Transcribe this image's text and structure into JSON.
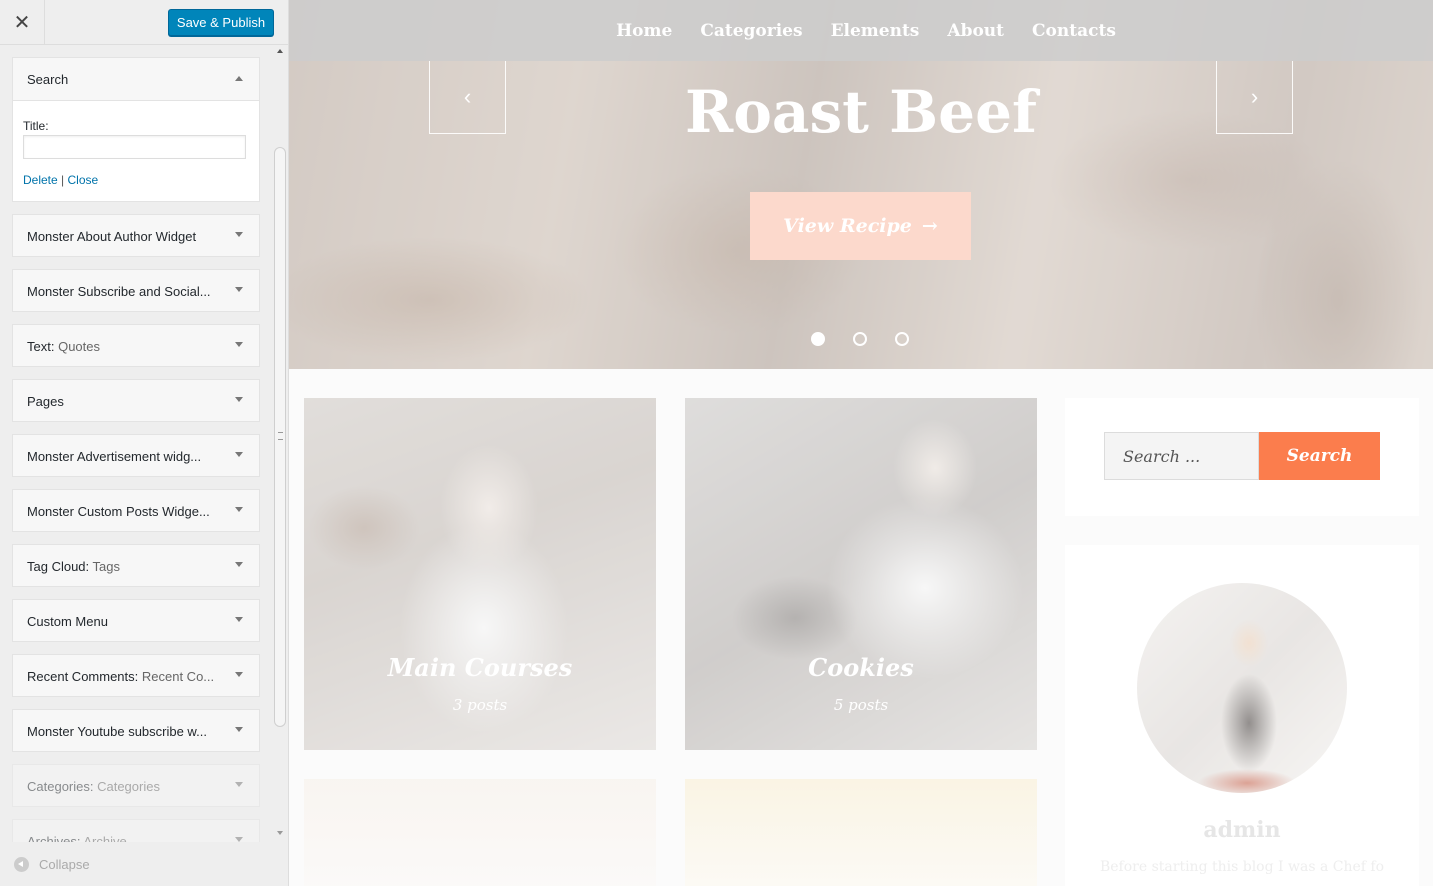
{
  "sidebar": {
    "close_glyph": "✕",
    "publish_label": "Save & Publish",
    "open_widget": {
      "title": "Search",
      "field_label": "Title:",
      "field_value": "",
      "delete_label": "Delete",
      "separator": "|",
      "close_label": "Close"
    },
    "widgets": [
      {
        "title": "Monster About Author Widget",
        "sub": ""
      },
      {
        "title": "Monster Subscribe and Social...",
        "sub": ""
      },
      {
        "title": "Text:",
        "sub": " Quotes"
      },
      {
        "title": "Pages",
        "sub": ""
      },
      {
        "title": "Monster Advertisement widg...",
        "sub": ""
      },
      {
        "title": "Monster Custom Posts Widge...",
        "sub": ""
      },
      {
        "title": "Tag Cloud:",
        "sub": " Tags"
      },
      {
        "title": "Custom Menu",
        "sub": ""
      },
      {
        "title": "Recent Comments:",
        "sub": " Recent Co..."
      },
      {
        "title": "Monster Youtube subscribe w...",
        "sub": ""
      },
      {
        "title": "Categories:",
        "sub": " Categories"
      },
      {
        "title": "Archives:",
        "sub": " Archive"
      }
    ],
    "collapse_label": "Collapse"
  },
  "preview": {
    "nav": [
      "Home",
      "Categories",
      "Elements",
      "About",
      "Contacts"
    ],
    "hero": {
      "title": "Roast Beef",
      "button_label": "View Recipe",
      "button_arrow": "→",
      "prev_glyph": "‹",
      "next_glyph": "›",
      "slide_count": 3,
      "active_slide": 1
    },
    "cards": [
      {
        "title": "Main Courses",
        "count": "3 posts"
      },
      {
        "title": "Cookies",
        "count": "5 posts"
      }
    ],
    "search": {
      "placeholder": "Search ...",
      "button_label": "Search"
    },
    "author": {
      "name": "admin",
      "bio": "Before starting this blog I was a Chef fo"
    }
  },
  "colors": {
    "publish_button": "#0085ba",
    "link": "#0073aa",
    "search_button": "#fb7d4d",
    "view_recipe_button": "#fcd9cc"
  }
}
